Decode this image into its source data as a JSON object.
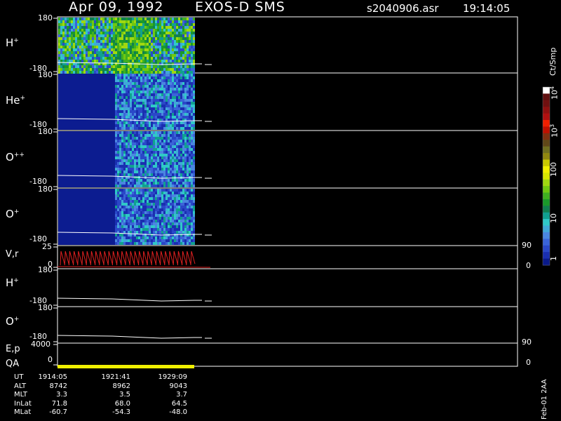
{
  "header": {
    "date": "Apr 09, 1992",
    "mission": "EXOS-D SMS",
    "file": "s2040906.asr",
    "time": "19:14:05"
  },
  "colorbar": {
    "unit": "Ct/Smp",
    "tick_labels": [
      "1",
      "10",
      "100",
      "10",
      "10"
    ],
    "tick_exponents": [
      "",
      "",
      "",
      "3",
      "4"
    ],
    "colors": [
      "#0a1a8a",
      "#1a2fb0",
      "#2a48c8",
      "#3a64d8",
      "#4a86e0",
      "#40a8d8",
      "#30c8c8",
      "#10a090",
      "#108050",
      "#1a9a2a",
      "#40b020",
      "#70c810",
      "#a0d810",
      "#d8e800",
      "#f0f000",
      "#c8c800",
      "#908810",
      "#707020",
      "#604818",
      "#803010",
      "#c01000",
      "#f02000",
      "#b01010",
      "#901010",
      "#701010",
      "#601010",
      "#ffffff"
    ]
  },
  "panels": [
    {
      "label": "H",
      "sup": "+",
      "top_tick": "180",
      "bot_tick": "-180"
    },
    {
      "label": "He",
      "sup": "+",
      "top_tick": "180",
      "bot_tick": "-180"
    },
    {
      "label": "O",
      "sup": "++",
      "top_tick": "180",
      "bot_tick": "-180"
    },
    {
      "label": "O",
      "sup": "+",
      "top_tick": "180",
      "bot_tick": "-180"
    },
    {
      "label": "V,r",
      "sup": "",
      "top_tick": "25",
      "bot_tick": "0",
      "right_top": "90",
      "right_bot": "0"
    },
    {
      "label": "H",
      "sup": "+",
      "top_tick": "180",
      "bot_tick": "-180"
    },
    {
      "label": "O",
      "sup": "+",
      "top_tick": "180",
      "bot_tick": "-180"
    },
    {
      "label": "E,p",
      "sup": "",
      "top_tick": "4000",
      "bot_tick": "0",
      "right_top": "90",
      "right_bot": "0"
    },
    {
      "label": "QA",
      "sup": "",
      "top_tick": "",
      "bot_tick": ""
    }
  ],
  "ephemeris": {
    "rows": [
      {
        "name": "UT",
        "values": [
          "1914:05",
          "1921:41",
          "1929:09"
        ]
      },
      {
        "name": "ALT",
        "values": [
          "8742",
          "8962",
          "9043"
        ]
      },
      {
        "name": "MLT",
        "values": [
          "3.3",
          "3.5",
          "3.7"
        ]
      },
      {
        "name": "InLat",
        "values": [
          "71.8",
          "68.0",
          "64.5"
        ]
      },
      {
        "name": "MLat",
        "values": [
          "-60.7",
          "-54.3",
          "-48.0"
        ]
      }
    ]
  },
  "stamp": "Feb-01 2AA",
  "chart_data": {
    "type": "heatmap",
    "title": "Apr 09, 1992   EXOS-D SMS",
    "x": [
      "1914:05",
      "1921:41",
      "1929:09"
    ],
    "panels": [
      "H+",
      "He+",
      "O++",
      "O+",
      "V,r",
      "H+",
      "O+",
      "E,p",
      "QA"
    ],
    "pitch_angle_range": [
      -180,
      180
    ],
    "velocity_range": [
      0,
      25
    ],
    "energy_range": [
      0,
      4000
    ],
    "colorbar_range": [
      1,
      10000
    ],
    "colorbar_scale": "log",
    "grid": false
  }
}
